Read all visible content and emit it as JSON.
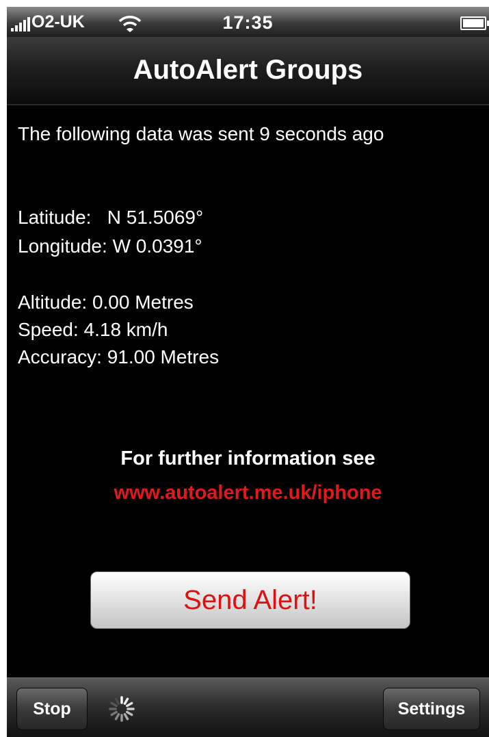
{
  "status_bar": {
    "carrier": "O2-UK",
    "time": "17:35",
    "icons": [
      "signal-icon",
      "wifi-icon",
      "battery-icon"
    ]
  },
  "nav": {
    "title": "AutoAlert Groups"
  },
  "content": {
    "sent_message": "The following data was sent 9 seconds ago",
    "latitude": "Latitude:   N 51.5069°",
    "longitude": "Longitude: W 0.0391°",
    "altitude": "Altitude: 0.00 Metres",
    "speed": "Speed: 4.18 km/h",
    "accuracy": "Accuracy: 91.00 Metres",
    "info_heading": "For further information see",
    "info_link": "www.autoalert.me.uk/iphone",
    "send_button": "Send Alert!"
  },
  "toolbar": {
    "stop_label": "Stop",
    "settings_label": "Settings",
    "spinner_icon": "activity-spinner-icon"
  },
  "colors": {
    "background": "#000000",
    "link": "#e01a1a",
    "send_text": "#e01010"
  }
}
